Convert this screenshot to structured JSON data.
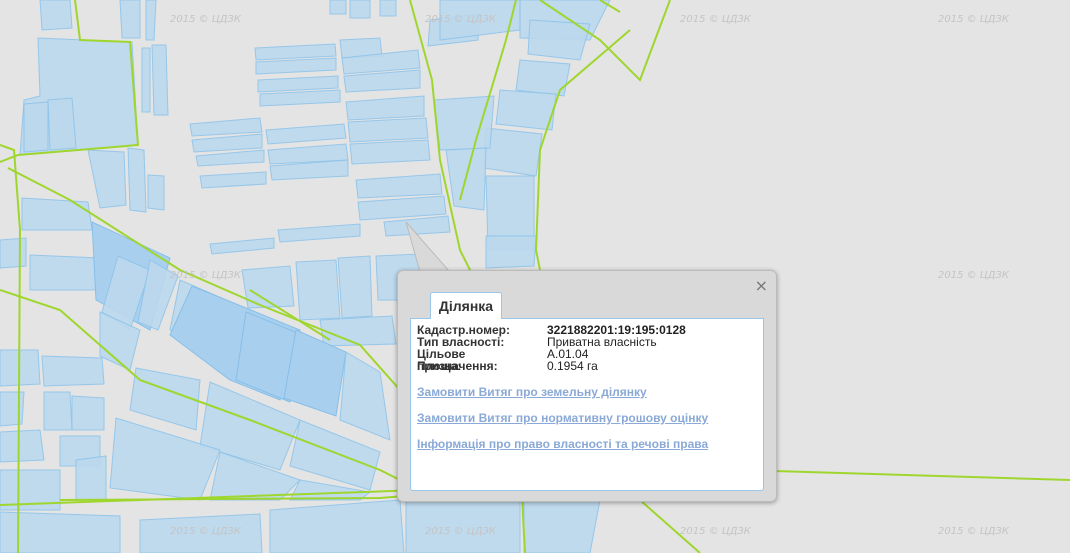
{
  "watermark_text": "2015 © ЦДЗК",
  "popup": {
    "tab_label": "Ділянка",
    "close_glyph": "×",
    "rows": [
      {
        "label": "Кадастр.номер:",
        "value": "3221882201:19:195:0128"
      },
      {
        "label": "Тип власності:",
        "value": "Приватна власність"
      },
      {
        "label": "Цільове призначення:",
        "value": "A.01.04"
      },
      {
        "label": "Площа:",
        "value": "0.1954 га"
      }
    ],
    "links": [
      "Замовити Витяг про земельну ділянку",
      "Замовити Витяг про нормативну грошову оцінку",
      "Інформація про право власності та речові права"
    ]
  },
  "colors": {
    "background": "#e4e4e4",
    "parcel_fill": "#bcd8ee",
    "parcel_stroke": "#8ec4ea",
    "road": "#9fd62e",
    "link": "#8aa9d6"
  }
}
